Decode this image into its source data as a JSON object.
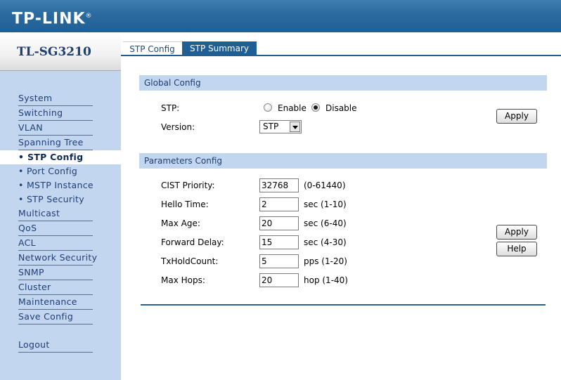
{
  "brand": {
    "logo_text": "TP-LINK",
    "logo_reg": "®"
  },
  "sidebar": {
    "model": "TL-SG3210",
    "items": [
      {
        "label": "System",
        "type": "main"
      },
      {
        "label": "Switching",
        "type": "main"
      },
      {
        "label": "VLAN",
        "type": "main"
      },
      {
        "label": "Spanning Tree",
        "type": "main"
      },
      {
        "label": "• STP Config",
        "type": "sub",
        "active": true
      },
      {
        "label": "• Port Config",
        "type": "sub"
      },
      {
        "label": "• MSTP Instance",
        "type": "sub"
      },
      {
        "label": "• STP Security",
        "type": "sub"
      },
      {
        "label": "Multicast",
        "type": "main"
      },
      {
        "label": "QoS",
        "type": "main"
      },
      {
        "label": "ACL",
        "type": "main"
      },
      {
        "label": "Network Security",
        "type": "main"
      },
      {
        "label": "SNMP",
        "type": "main"
      },
      {
        "label": "Cluster",
        "type": "main"
      },
      {
        "label": "Maintenance",
        "type": "main"
      },
      {
        "label": "Save Config",
        "type": "main"
      }
    ],
    "logout": "Logout"
  },
  "tabs": [
    {
      "label": "STP Config",
      "active": true
    },
    {
      "label": "STP Summary",
      "active": false
    }
  ],
  "global_config": {
    "title": "Global Config",
    "stp_label": "STP:",
    "enable_label": "Enable",
    "disable_label": "Disable",
    "stp_selected": "Disable",
    "version_label": "Version:",
    "version_value": "STP",
    "apply_label": "Apply"
  },
  "parameters_config": {
    "title": "Parameters Config",
    "fields": [
      {
        "label": "CIST Priority:",
        "value": "32768",
        "unit": "(0-61440)"
      },
      {
        "label": "Hello Time:",
        "value": "2",
        "unit": "sec (1-10)"
      },
      {
        "label": "Max Age:",
        "value": "20",
        "unit": "sec (6-40)"
      },
      {
        "label": "Forward Delay:",
        "value": "15",
        "unit": "sec (4-30)"
      },
      {
        "label": "TxHoldCount:",
        "value": "5",
        "unit": "pps (1-20)"
      },
      {
        "label": "Max Hops:",
        "value": "20",
        "unit": "hop (1-40)"
      }
    ],
    "apply_label": "Apply",
    "help_label": "Help"
  },
  "colors": {
    "header": "#1f5f94",
    "sidebar": "#c3d6f0",
    "section_bar": "#c3d6f0",
    "active_tab_text": "#1a4d80"
  }
}
